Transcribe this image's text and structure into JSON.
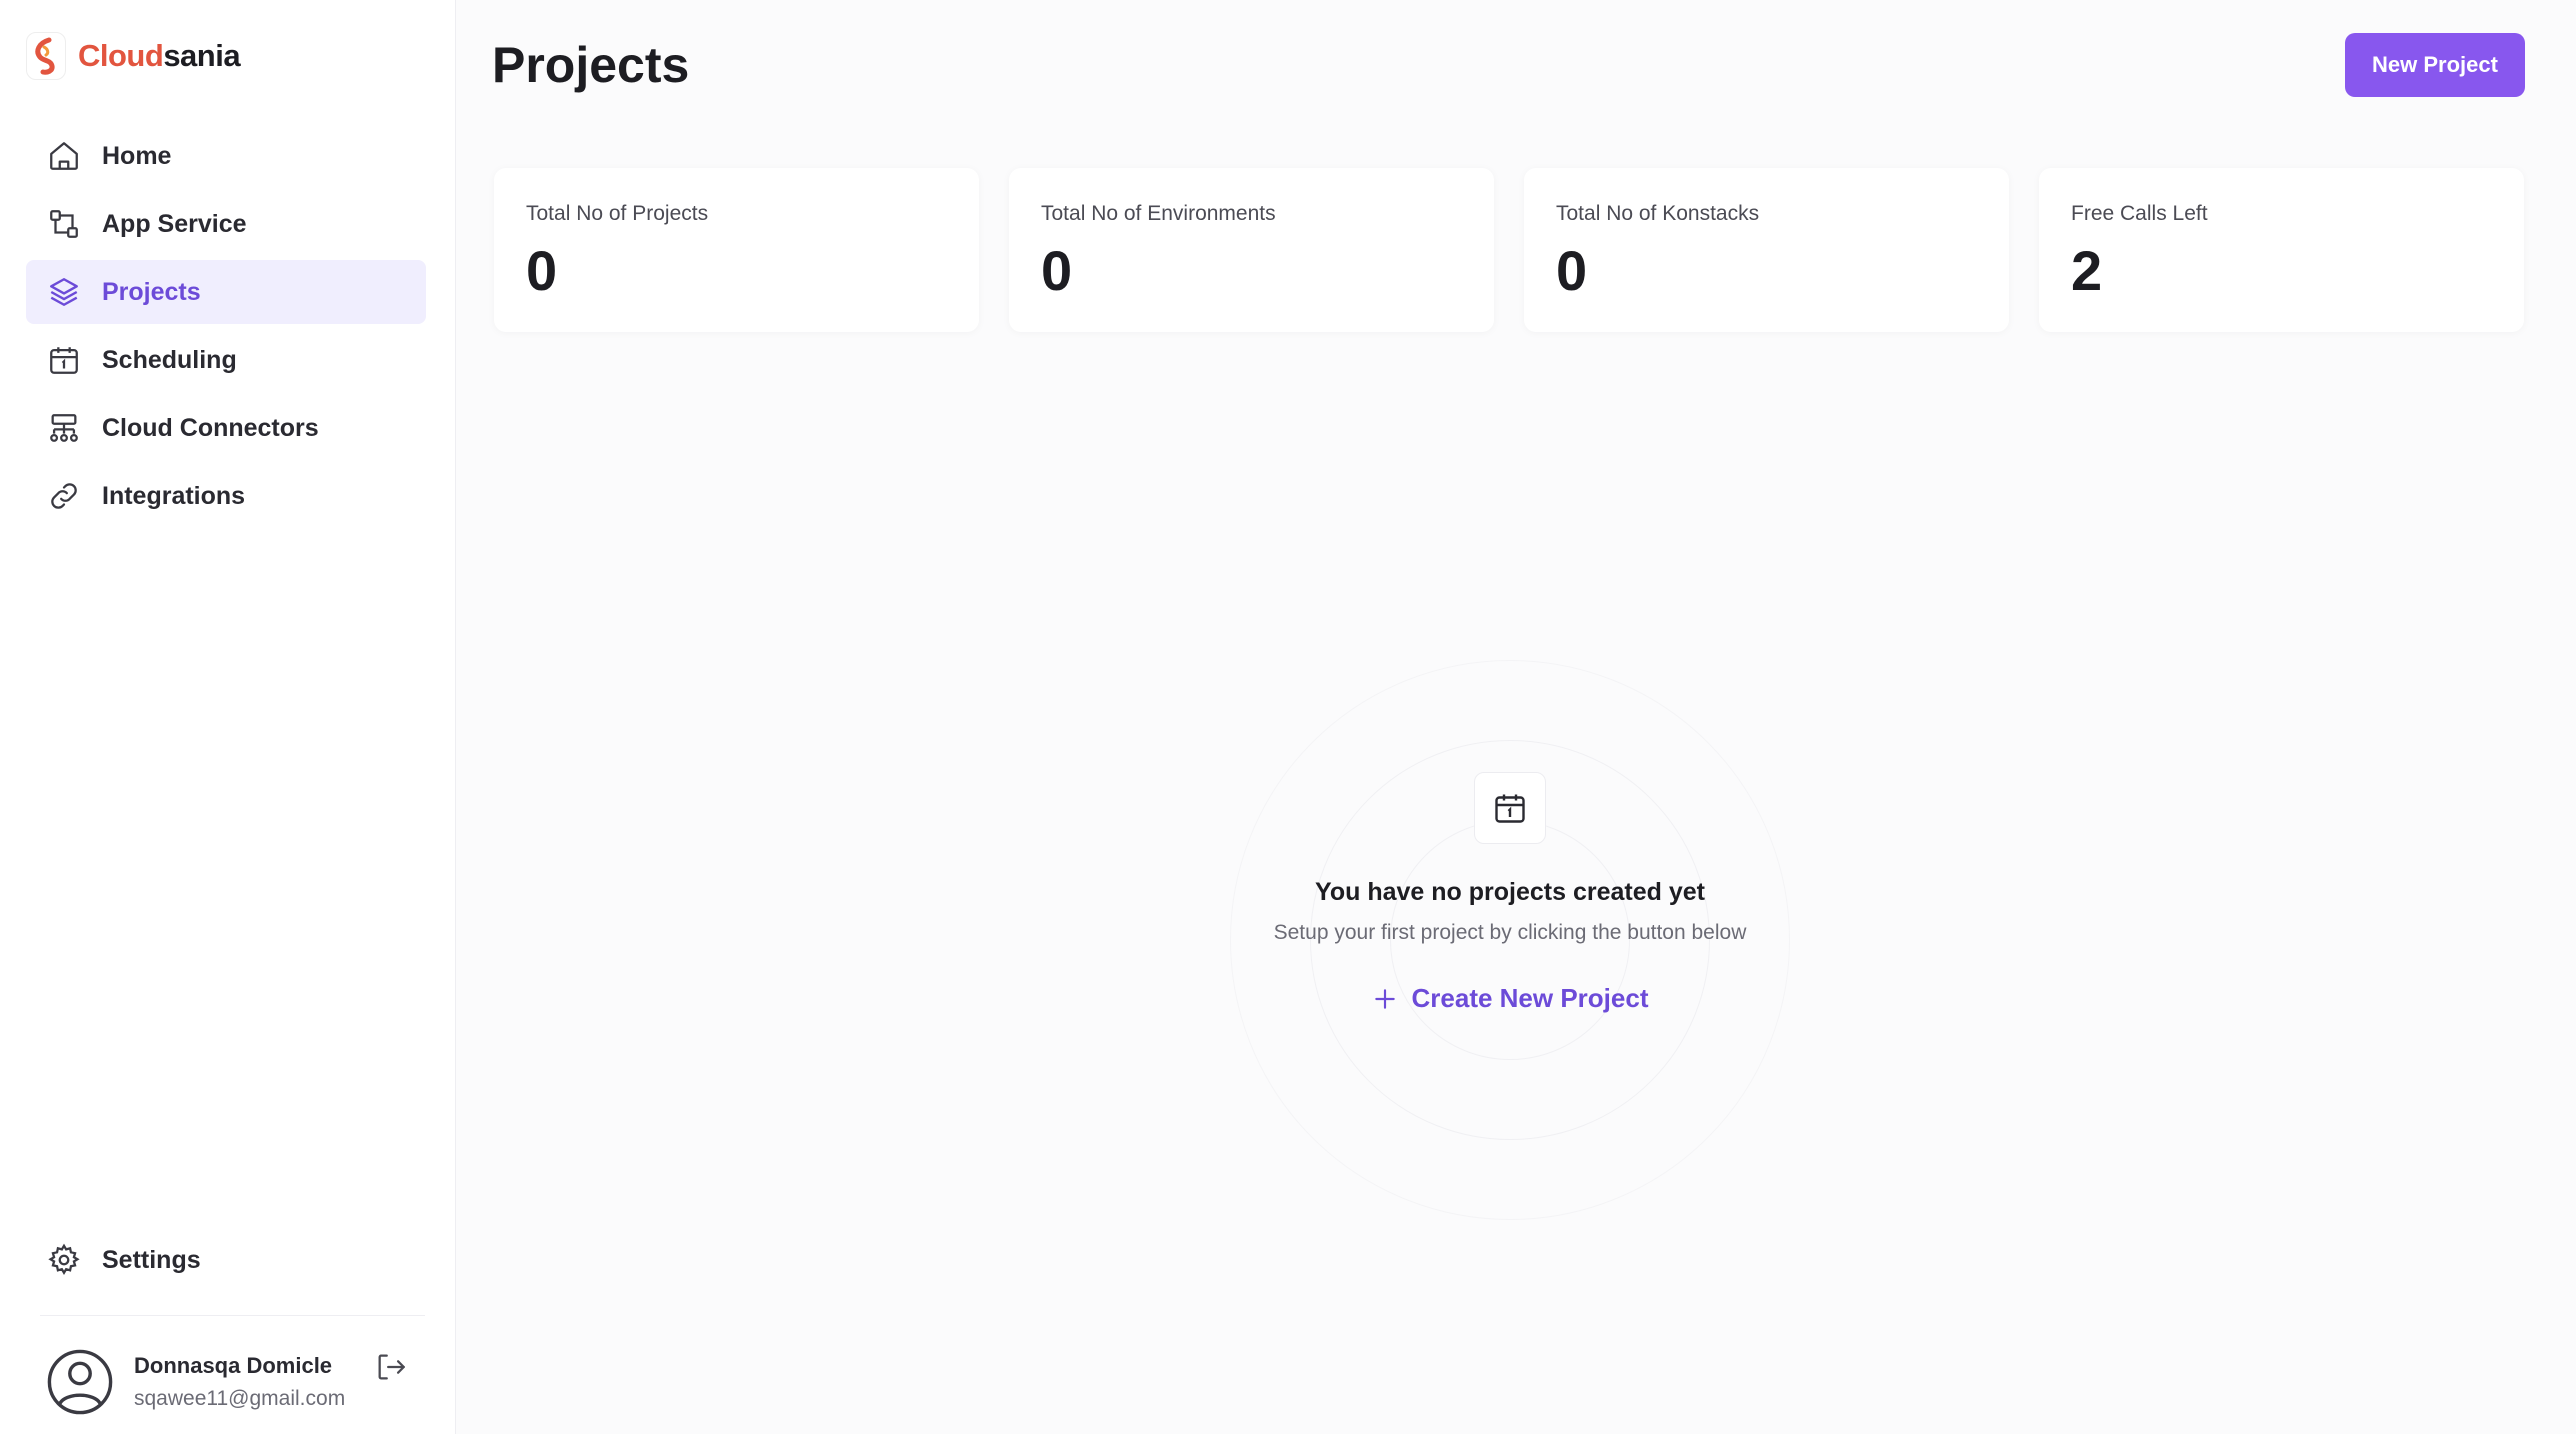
{
  "brand": {
    "part1": "Cloud",
    "part2": "sania",
    "accent": "#e2553f"
  },
  "sidebar": {
    "items": [
      {
        "label": "Home",
        "icon": "home-icon"
      },
      {
        "label": "App Service",
        "icon": "app-service-icon"
      },
      {
        "label": "Projects",
        "icon": "layers-icon",
        "active": true
      },
      {
        "label": "Scheduling",
        "icon": "calendar-icon"
      },
      {
        "label": "Cloud Connectors",
        "icon": "network-icon"
      },
      {
        "label": "Integrations",
        "icon": "link-icon"
      }
    ],
    "settings_label": "Settings",
    "user": {
      "name": "Donnasqa Domicle",
      "email": "sqawee11@gmail.com"
    }
  },
  "header": {
    "title": "Projects",
    "new_project_label": "New Project",
    "button_color": "#8857ee"
  },
  "stats": [
    {
      "label": "Total No of Projects",
      "value": "0"
    },
    {
      "label": "Total No of Environments",
      "value": "0"
    },
    {
      "label": "Total No of Konstacks",
      "value": "0"
    },
    {
      "label": "Free Calls Left",
      "value": "2"
    }
  ],
  "empty_state": {
    "title": "You have no projects created yet",
    "subtitle": "Setup your first project by clicking the button below",
    "create_label": "Create New Project",
    "icon": "calendar-icon"
  },
  "colors": {
    "accent": "#6c4bd8",
    "active_bg": "#f0eefe"
  }
}
